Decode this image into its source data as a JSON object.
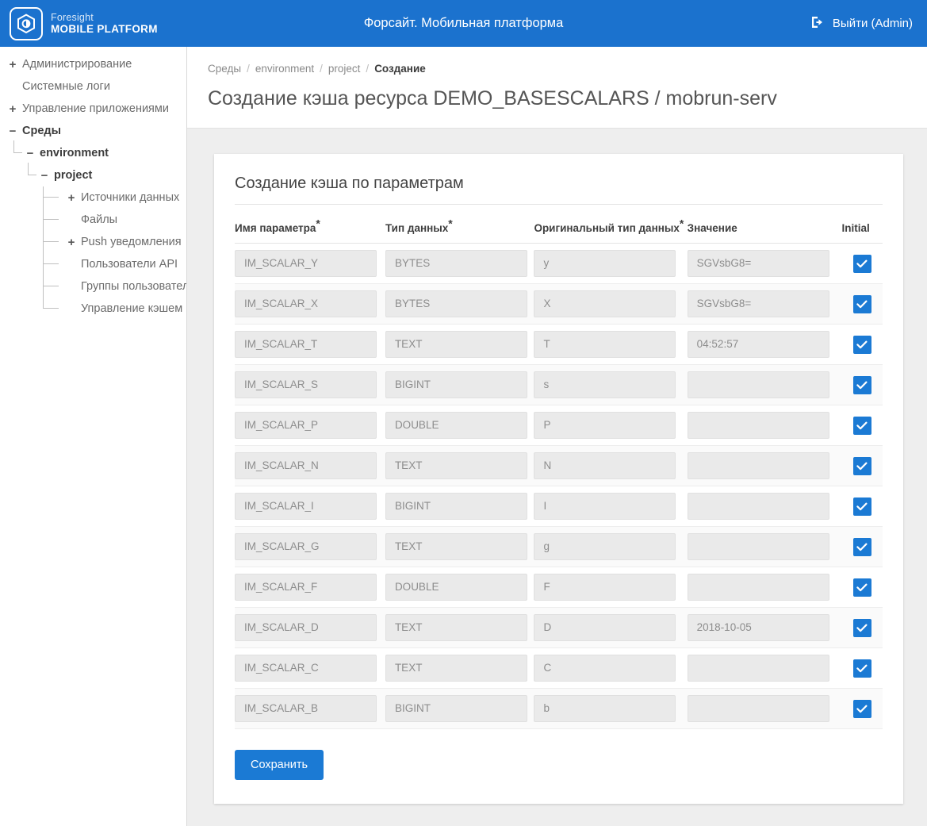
{
  "brand": {
    "line1": "Foresight",
    "line2": "MOBILE PLATFORM",
    "logo_icon": "hexagon-logo-icon"
  },
  "header": {
    "title": "Форсайт. Мобильная платформа",
    "logout_label": "Выйти (Admin)",
    "logout_icon": "sign-out-icon",
    "background_color": "#1b72ce"
  },
  "sidebar": {
    "items": [
      {
        "label": "Администрирование",
        "expander": "+",
        "level": 0,
        "bold": false
      },
      {
        "label": "Системные логи",
        "expander": "",
        "level": 0,
        "bold": false
      },
      {
        "label": "Управление приложениями",
        "expander": "+",
        "level": 0,
        "bold": false
      },
      {
        "label": "Среды",
        "expander": "−",
        "level": 0,
        "bold": true
      },
      {
        "label": "environment",
        "expander": "−",
        "level": 1,
        "bold": true
      },
      {
        "label": "project",
        "expander": "−",
        "level": 2,
        "bold": true
      },
      {
        "label": "Источники данных",
        "expander": "+",
        "level": 3,
        "bold": false
      },
      {
        "label": "Файлы",
        "expander": "",
        "level": 3,
        "bold": false
      },
      {
        "label": "Push уведомления",
        "expander": "+",
        "level": 3,
        "bold": false
      },
      {
        "label": "Пользователи API",
        "expander": "",
        "level": 3,
        "bold": false
      },
      {
        "label": "Группы пользователей",
        "expander": "",
        "level": 3,
        "bold": false
      },
      {
        "label": "Управление кэшем",
        "expander": "",
        "level": 3,
        "bold": false
      }
    ]
  },
  "breadcrumb": {
    "items": [
      "Среды",
      "environment",
      "project"
    ],
    "current": "Создание",
    "separator": "/"
  },
  "page": {
    "title": "Создание кэша ресурса DEMO_BASESCALARS / mobrun-serv"
  },
  "card": {
    "title": "Создание кэша по параметрам",
    "columns": [
      {
        "label": "Имя параметра",
        "required": true
      },
      {
        "label": "Тип данных",
        "required": true
      },
      {
        "label": "Оригинальный тип данных",
        "required": true
      },
      {
        "label": "Значение",
        "required": false
      },
      {
        "label": "Initial",
        "required": false
      }
    ],
    "rows": [
      {
        "name": "IM_SCALAR_Y",
        "type": "BYTES",
        "orig": "y",
        "value": "SGVsbG8=",
        "initial": true
      },
      {
        "name": "IM_SCALAR_X",
        "type": "BYTES",
        "orig": "X",
        "value": "SGVsbG8=",
        "initial": true
      },
      {
        "name": "IM_SCALAR_T",
        "type": "TEXT",
        "orig": "T",
        "value": "04:52:57",
        "initial": true
      },
      {
        "name": "IM_SCALAR_S",
        "type": "BIGINT",
        "orig": "s",
        "value": "",
        "initial": true
      },
      {
        "name": "IM_SCALAR_P",
        "type": "DOUBLE",
        "orig": "P",
        "value": "",
        "initial": true
      },
      {
        "name": "IM_SCALAR_N",
        "type": "TEXT",
        "orig": "N",
        "value": "",
        "initial": true
      },
      {
        "name": "IM_SCALAR_I",
        "type": "BIGINT",
        "orig": "I",
        "value": "",
        "initial": true
      },
      {
        "name": "IM_SCALAR_G",
        "type": "TEXT",
        "orig": "g",
        "value": "",
        "initial": true
      },
      {
        "name": "IM_SCALAR_F",
        "type": "DOUBLE",
        "orig": "F",
        "value": "",
        "initial": true
      },
      {
        "name": "IM_SCALAR_D",
        "type": "TEXT",
        "orig": "D",
        "value": "2018-10-05",
        "initial": true
      },
      {
        "name": "IM_SCALAR_C",
        "type": "TEXT",
        "orig": "C",
        "value": "",
        "initial": true
      },
      {
        "name": "IM_SCALAR_B",
        "type": "BIGINT",
        "orig": "b",
        "value": "",
        "initial": true
      }
    ],
    "save_label": "Сохранить"
  },
  "colors": {
    "accent": "#1b7ad4",
    "header": "#1b72ce",
    "page_bg": "#eeeeee",
    "field_bg": "#eaeaea"
  }
}
